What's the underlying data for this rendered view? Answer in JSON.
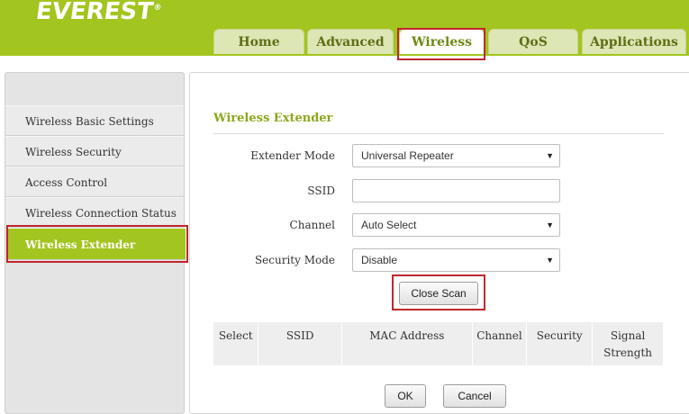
{
  "brand": {
    "logo_text": "EVEREST",
    "logo_mark": "®"
  },
  "nav": {
    "tabs": [
      {
        "label": "Home",
        "active": false
      },
      {
        "label": "Advanced",
        "active": false
      },
      {
        "label": "Wireless",
        "active": true
      },
      {
        "label": "QoS",
        "active": false
      },
      {
        "label": "Applications",
        "active": false
      }
    ]
  },
  "sidebar": {
    "items": [
      {
        "label": "Wireless Basic Settings",
        "active": false
      },
      {
        "label": "Wireless Security",
        "active": false
      },
      {
        "label": "Access Control",
        "active": false
      },
      {
        "label": "Wireless Connection Status",
        "active": false
      },
      {
        "label": "Wireless Extender",
        "active": true
      }
    ]
  },
  "main": {
    "section_title": "Wireless Extender",
    "form": {
      "extender_mode": {
        "label": "Extender Mode",
        "value": "Universal Repeater"
      },
      "ssid": {
        "label": "SSID",
        "value": "",
        "placeholder": ""
      },
      "channel": {
        "label": "Channel",
        "value": "Auto Select"
      },
      "security_mode": {
        "label": "Security Mode",
        "value": "Disable"
      }
    },
    "close_scan_label": "Close Scan",
    "scan_table": {
      "columns": [
        "Select",
        "SSID",
        "MAC Address",
        "Channel",
        "Security",
        "Signal Strength"
      ]
    },
    "ok_label": "OK",
    "cancel_label": "Cancel"
  },
  "colors": {
    "brand_green": "#a2c51f",
    "highlight_red": "#c0272d",
    "title_green": "#8aa81c"
  }
}
